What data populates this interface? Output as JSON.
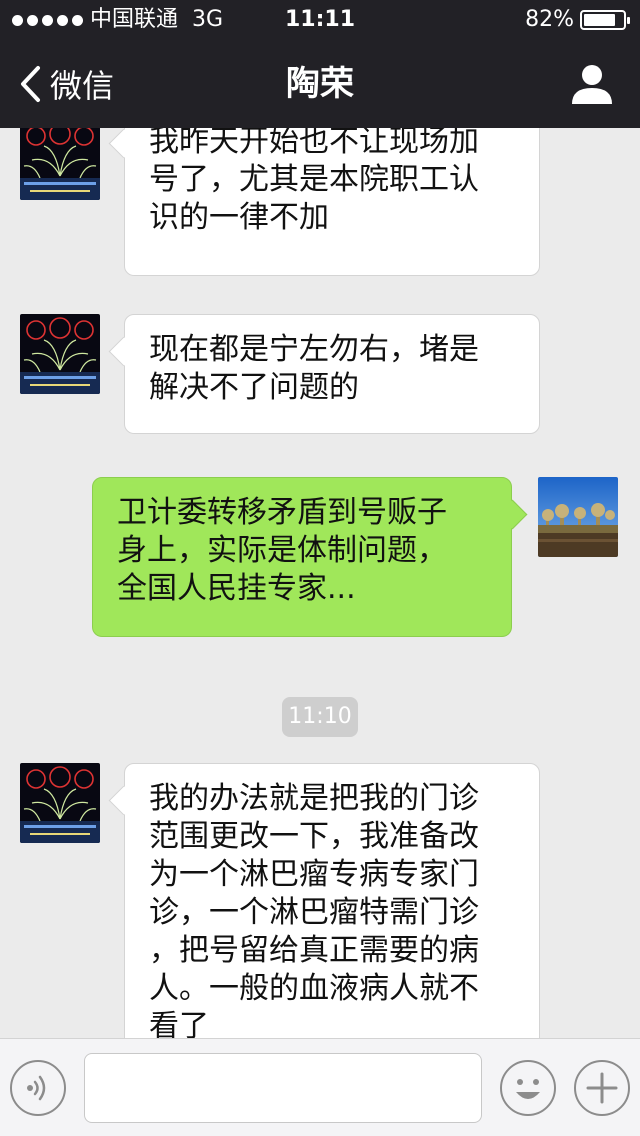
{
  "status_bar": {
    "carrier": "中国联通",
    "network": "3G",
    "time": "11:11",
    "battery_percent": "82%",
    "battery_level": 0.82
  },
  "nav": {
    "back_label": "微信",
    "title": "陶荣",
    "profile_icon": "person-icon"
  },
  "messages": [
    {
      "side": "left",
      "text": "我昨天开始也不让现场加\n号了，尤其是本院职工认\n识的一律不加"
    },
    {
      "side": "left",
      "text": "现在都是宁左勿右，堵是\n解决不了问题的"
    },
    {
      "side": "right",
      "text": "卫计委转移矛盾到号贩子\n身上，实际是体制问题，\n全国人民挂专家..."
    },
    {
      "timestamp": "11:10"
    },
    {
      "side": "left",
      "text": "我的办法就是把我的门诊\n范围更改一下，我准备改\n为一个淋巴瘤专病专家门\n诊，一个淋巴瘤特需门诊\n，把号留给真正需要的病\n人。一般的血液病人就不\n看了"
    }
  ],
  "input_bar": {
    "input_value": "",
    "voice_icon": "voice-icon",
    "emoji_icon": "emoji-icon",
    "plus_icon": "plus-icon"
  },
  "colors": {
    "nav_background": "#222126",
    "chat_background": "#ebebeb",
    "sent_bubble": "#a0e75a",
    "received_bubble": "#ffffff"
  }
}
